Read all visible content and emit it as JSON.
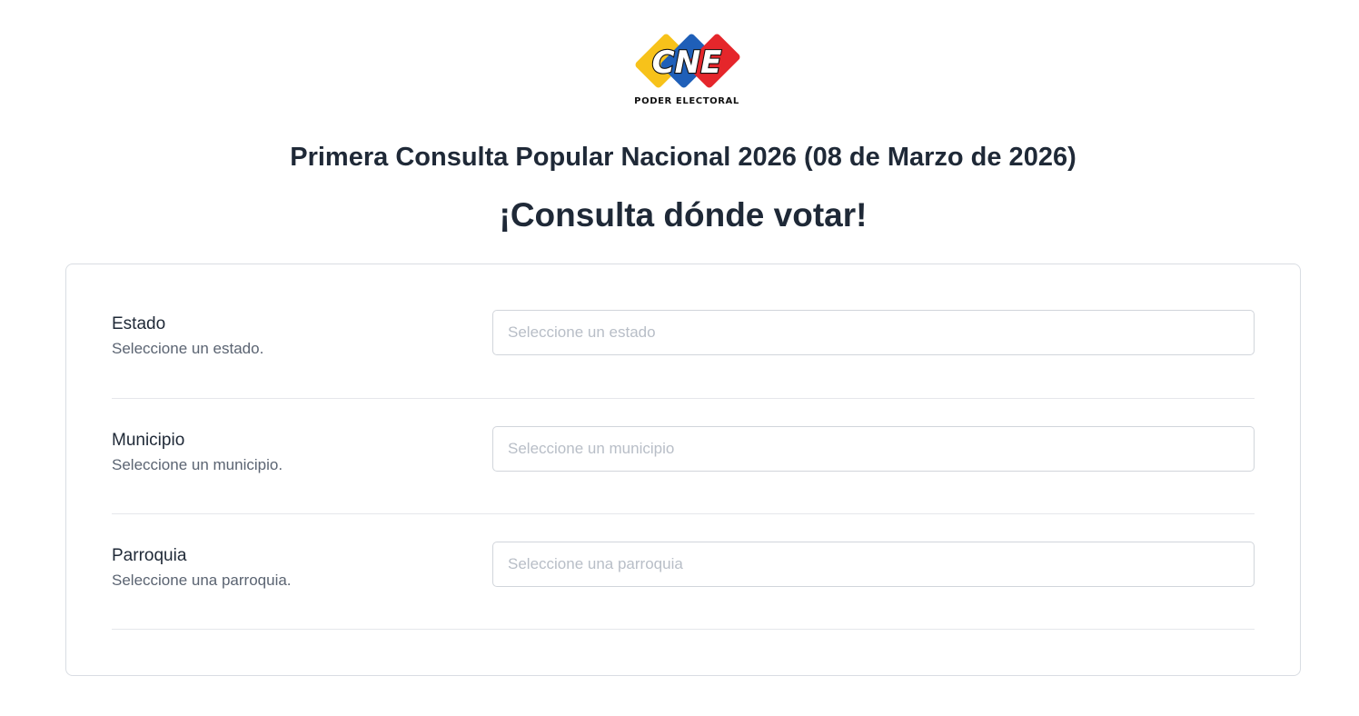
{
  "header": {
    "logo_text": "CNE",
    "logo_caption": "PODER ELECTORAL",
    "subtitle": "Primera Consulta Popular Nacional 2026 (08 de Marzo de 2026)",
    "title": "¡Consulta dónde votar!"
  },
  "colors": {
    "logo_yellow": "#f7c21a",
    "logo_blue": "#1f5fb8",
    "logo_red": "#e5262b",
    "text_dark": "#1f2937",
    "text_muted": "#5b6472",
    "placeholder": "#b8bec7",
    "border": "#d1d5db"
  },
  "form": {
    "fields": [
      {
        "label": "Estado",
        "help": "Seleccione un estado.",
        "value": "",
        "placeholder": "Seleccione un estado"
      },
      {
        "label": "Municipio",
        "help": "Seleccione un municipio.",
        "value": "",
        "placeholder": "Seleccione un municipio"
      },
      {
        "label": "Parroquia",
        "help": "Seleccione una parroquia.",
        "value": "",
        "placeholder": "Seleccione una parroquia"
      }
    ]
  }
}
